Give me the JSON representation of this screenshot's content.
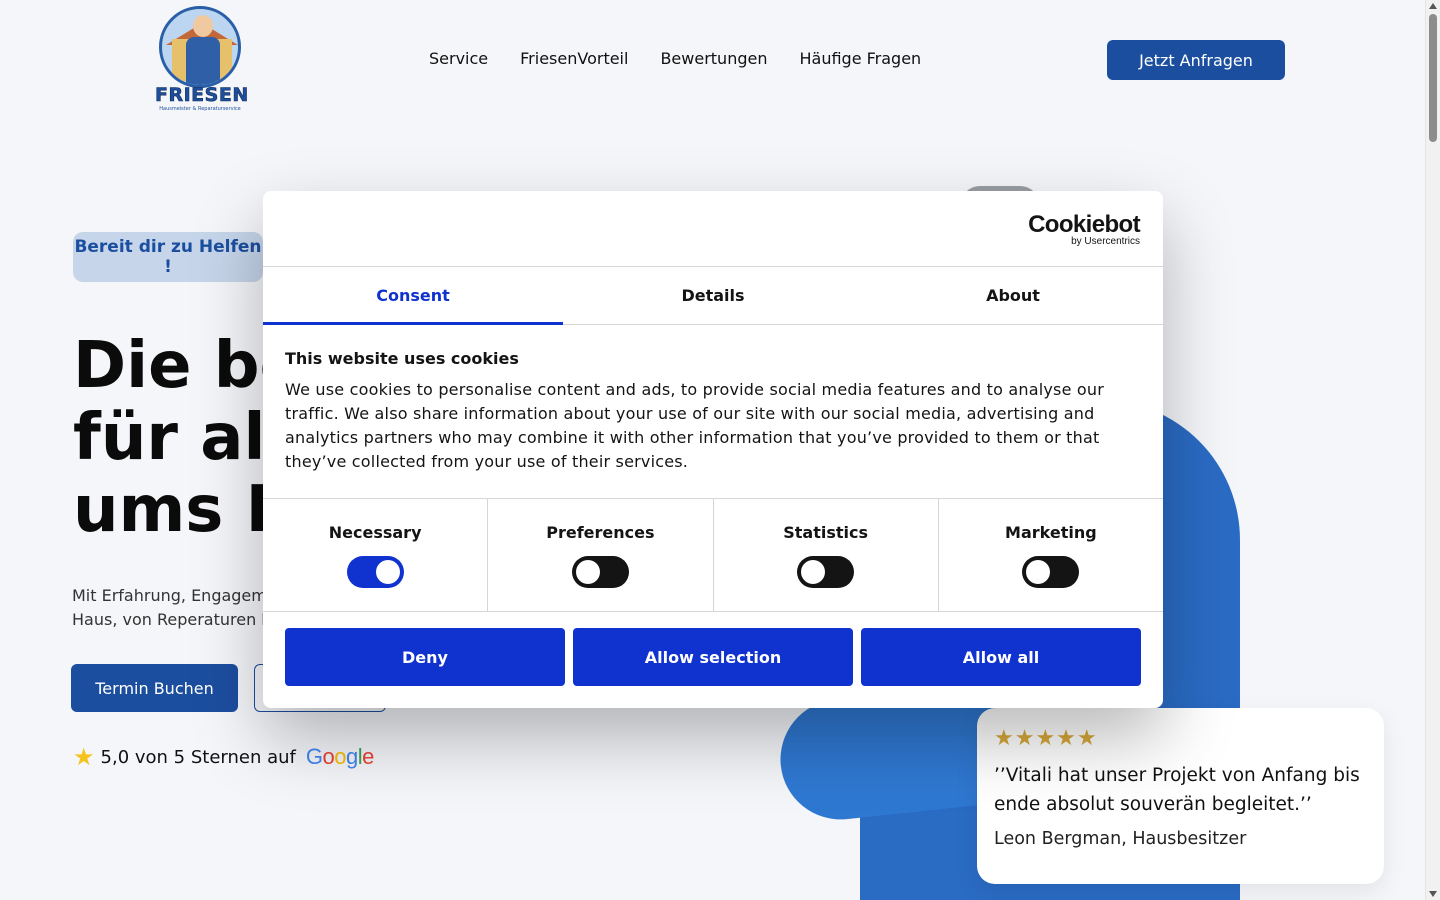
{
  "header": {
    "logo_text": "FRIESEN",
    "logo_subtitle": "Hausmeister & Reparaturservice",
    "nav": [
      "Service",
      "FriesenVorteil",
      "Bewertungen",
      "Häufige Fragen"
    ],
    "cta_label": "Jetzt Anfragen"
  },
  "hero": {
    "badge": "Bereit dir zu Helfen !",
    "title_lines": [
      "Die be",
      "für all",
      "ums H"
    ],
    "desc_lines": [
      "Mit Erfahrung, Engagem",
      "Haus, von Reperaturen l"
    ],
    "primary_button": "Termin Buchen",
    "rating_text": "5,0 von 5 Sternen auf",
    "rating_provider": [
      "G",
      "o",
      "o",
      "g",
      "l",
      "e"
    ]
  },
  "review": {
    "stars": "★★★★★",
    "quote": "’’Vitali hat unser Projekt von Anfang bis ende absolut souverän begleitet.’’",
    "author": "Leon Bergman, Hausbesitzer"
  },
  "cookie": {
    "logo_main": "Cookiebot",
    "logo_sub": "by Usercentrics",
    "tabs": [
      "Consent",
      "Details",
      "About"
    ],
    "heading": "This website uses cookies",
    "text": "We use cookies to personalise content and ads, to provide social media features and to analyse our traffic. We also share information about your use of our site with our social media, advertising and analytics partners who may combine it with other information that you’ve provided to them or that they’ve collected from your use of their services.",
    "categories": [
      {
        "label": "Necessary",
        "enabled": true
      },
      {
        "label": "Preferences",
        "enabled": false
      },
      {
        "label": "Statistics",
        "enabled": false
      },
      {
        "label": "Marketing",
        "enabled": false
      }
    ],
    "buttons": [
      "Deny",
      "Allow selection",
      "Allow all"
    ]
  },
  "colors": {
    "brand_blue": "#1c4ea0",
    "cookiebot_blue": "#1032cf",
    "star_gold": "#d8a93a"
  }
}
